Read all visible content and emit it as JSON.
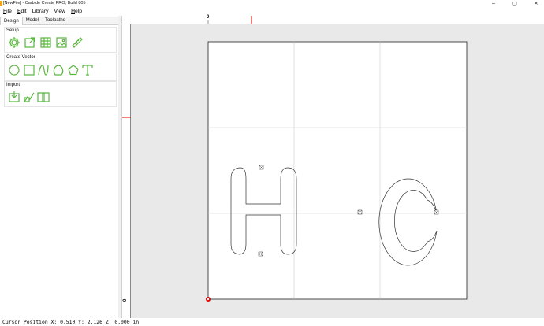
{
  "window": {
    "title": "[NewFile] - Carbide Create PRO, Build 805",
    "controls": {
      "minimize": "–",
      "maximize": "▢",
      "close": "✕"
    }
  },
  "menu": {
    "items": [
      {
        "label": "File",
        "mnemonic": "F",
        "rest": "ile"
      },
      {
        "label": "Edit",
        "mnemonic": "E",
        "rest": "dit"
      },
      {
        "label": "Library",
        "mnemonic": "",
        "rest": "Library"
      },
      {
        "label": "View",
        "mnemonic": "",
        "rest": "View"
      },
      {
        "label": "Help",
        "mnemonic": "H",
        "rest": "elp"
      }
    ]
  },
  "tabs": [
    {
      "label": "Design",
      "active": true
    },
    {
      "label": "Model",
      "active": false
    },
    {
      "label": "Toolpaths",
      "active": false
    }
  ],
  "sections": {
    "setup": {
      "label": "Setup",
      "tools": [
        "job-setup-gear-icon",
        "edit-job-icon",
        "grid-icon",
        "image-icon",
        "ruler-icon"
      ]
    },
    "create_vector": {
      "label": "Create Vector",
      "tools": [
        "circle-icon",
        "rectangle-icon",
        "curve-icon",
        "polygon-shape-icon",
        "pentagon-icon",
        "text-icon"
      ]
    },
    "import": {
      "label": "Import",
      "tools": [
        "import-svg-icon",
        "import-image-icon",
        "library-book-icon"
      ]
    }
  },
  "rulers": {
    "top_zero_label": "0",
    "left_zero_label": "0"
  },
  "colors": {
    "accent": "#5ab63f",
    "marker": "#e00000",
    "canvas_bg": "#e9e9e9",
    "stock": "#ffffff"
  },
  "status": {
    "text": "Cursor Position X: 0.510 Y: 2.126 Z: 0.000 in"
  }
}
